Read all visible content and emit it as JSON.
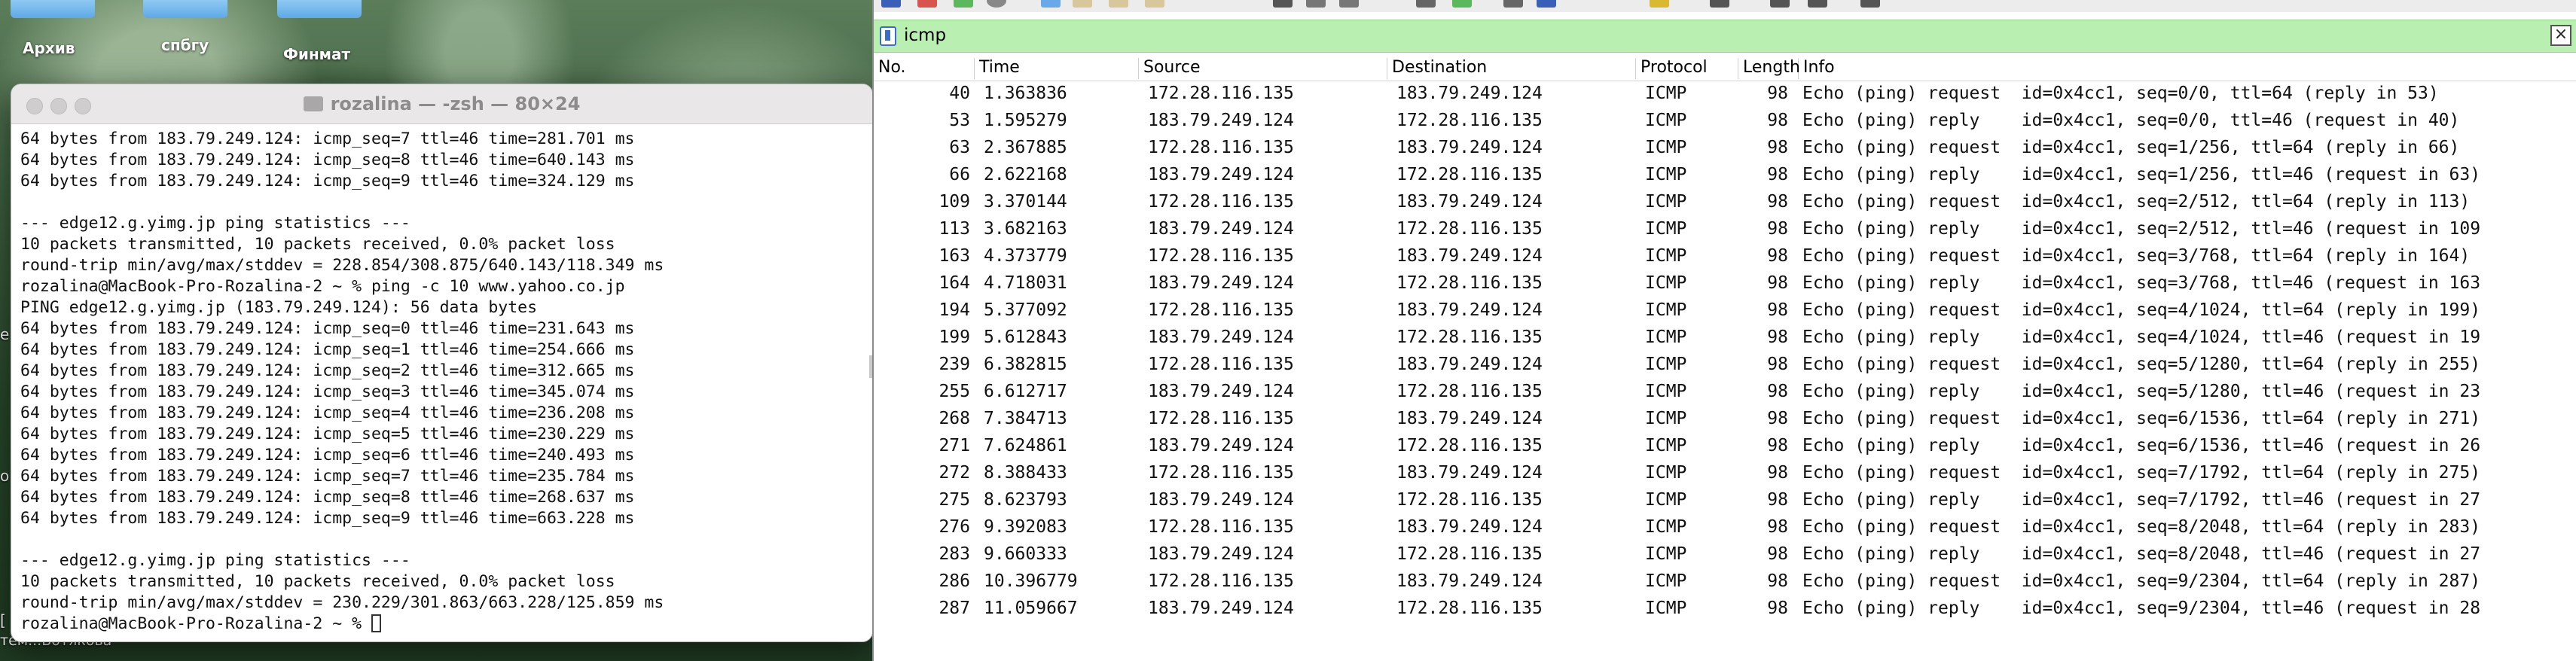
{
  "desktop": {
    "folder_labels": [
      "Архив",
      "спбгу",
      "Финмат"
    ],
    "bottom_label": "тем...Вотякова",
    "edge_glyphs": [
      "е",
      "о",
      "["
    ]
  },
  "terminal": {
    "title": "rozalina — -zsh — 80×24",
    "lines": [
      "64 bytes from 183.79.249.124: icmp_seq=7 ttl=46 time=281.701 ms",
      "64 bytes from 183.79.249.124: icmp_seq=8 ttl=46 time=640.143 ms",
      "64 bytes from 183.79.249.124: icmp_seq=9 ttl=46 time=324.129 ms",
      "",
      "--- edge12.g.yimg.jp ping statistics ---",
      "10 packets transmitted, 10 packets received, 0.0% packet loss",
      "round-trip min/avg/max/stddev = 228.854/308.875/640.143/118.349 ms",
      "rozalina@MacBook-Pro-Rozalina-2 ~ % ping -c 10 www.yahoo.co.jp",
      "PING edge12.g.yimg.jp (183.79.249.124): 56 data bytes",
      "64 bytes from 183.79.249.124: icmp_seq=0 ttl=46 time=231.643 ms",
      "64 bytes from 183.79.249.124: icmp_seq=1 ttl=46 time=254.666 ms",
      "64 bytes from 183.79.249.124: icmp_seq=2 ttl=46 time=312.665 ms",
      "64 bytes from 183.79.249.124: icmp_seq=3 ttl=46 time=345.074 ms",
      "64 bytes from 183.79.249.124: icmp_seq=4 ttl=46 time=236.208 ms",
      "64 bytes from 183.79.249.124: icmp_seq=5 ttl=46 time=230.229 ms",
      "64 bytes from 183.79.249.124: icmp_seq=6 ttl=46 time=240.493 ms",
      "64 bytes from 183.79.249.124: icmp_seq=7 ttl=46 time=235.784 ms",
      "64 bytes from 183.79.249.124: icmp_seq=8 ttl=46 time=268.637 ms",
      "64 bytes from 183.79.249.124: icmp_seq=9 ttl=46 time=663.228 ms",
      "",
      "--- edge12.g.yimg.jp ping statistics ---",
      "10 packets transmitted, 10 packets received, 0.0% packet loss",
      "round-trip min/avg/max/stddev = 230.229/301.863/663.228/125.859 ms"
    ],
    "prompt": "rozalina@MacBook-Pro-Rozalina-2 ~ % "
  },
  "wireshark": {
    "filter": {
      "value": "icmp"
    },
    "columns": [
      "No.",
      "Time",
      "Source",
      "Destination",
      "Protocol",
      "Length",
      "Info"
    ],
    "packets": [
      {
        "no": "40",
        "time": "1.363836",
        "src": "172.28.116.135",
        "dst": "183.79.249.124",
        "proto": "ICMP",
        "len": "98",
        "info": "Echo (ping) request  id=0x4cc1, seq=0/0, ttl=64 (reply in 53)"
      },
      {
        "no": "53",
        "time": "1.595279",
        "src": "183.79.249.124",
        "dst": "172.28.116.135",
        "proto": "ICMP",
        "len": "98",
        "info": "Echo (ping) reply    id=0x4cc1, seq=0/0, ttl=46 (request in 40)"
      },
      {
        "no": "63",
        "time": "2.367885",
        "src": "172.28.116.135",
        "dst": "183.79.249.124",
        "proto": "ICMP",
        "len": "98",
        "info": "Echo (ping) request  id=0x4cc1, seq=1/256, ttl=64 (reply in 66)"
      },
      {
        "no": "66",
        "time": "2.622168",
        "src": "183.79.249.124",
        "dst": "172.28.116.135",
        "proto": "ICMP",
        "len": "98",
        "info": "Echo (ping) reply    id=0x4cc1, seq=1/256, ttl=46 (request in 63)"
      },
      {
        "no": "109",
        "time": "3.370144",
        "src": "172.28.116.135",
        "dst": "183.79.249.124",
        "proto": "ICMP",
        "len": "98",
        "info": "Echo (ping) request  id=0x4cc1, seq=2/512, ttl=64 (reply in 113)"
      },
      {
        "no": "113",
        "time": "3.682163",
        "src": "183.79.249.124",
        "dst": "172.28.116.135",
        "proto": "ICMP",
        "len": "98",
        "info": "Echo (ping) reply    id=0x4cc1, seq=2/512, ttl=46 (request in 109"
      },
      {
        "no": "163",
        "time": "4.373779",
        "src": "172.28.116.135",
        "dst": "183.79.249.124",
        "proto": "ICMP",
        "len": "98",
        "info": "Echo (ping) request  id=0x4cc1, seq=3/768, ttl=64 (reply in 164)"
      },
      {
        "no": "164",
        "time": "4.718031",
        "src": "183.79.249.124",
        "dst": "172.28.116.135",
        "proto": "ICMP",
        "len": "98",
        "info": "Echo (ping) reply    id=0x4cc1, seq=3/768, ttl=46 (request in 163"
      },
      {
        "no": "194",
        "time": "5.377092",
        "src": "172.28.116.135",
        "dst": "183.79.249.124",
        "proto": "ICMP",
        "len": "98",
        "info": "Echo (ping) request  id=0x4cc1, seq=4/1024, ttl=64 (reply in 199)"
      },
      {
        "no": "199",
        "time": "5.612843",
        "src": "183.79.249.124",
        "dst": "172.28.116.135",
        "proto": "ICMP",
        "len": "98",
        "info": "Echo (ping) reply    id=0x4cc1, seq=4/1024, ttl=46 (request in 19"
      },
      {
        "no": "239",
        "time": "6.382815",
        "src": "172.28.116.135",
        "dst": "183.79.249.124",
        "proto": "ICMP",
        "len": "98",
        "info": "Echo (ping) request  id=0x4cc1, seq=5/1280, ttl=64 (reply in 255)"
      },
      {
        "no": "255",
        "time": "6.612717",
        "src": "183.79.249.124",
        "dst": "172.28.116.135",
        "proto": "ICMP",
        "len": "98",
        "info": "Echo (ping) reply    id=0x4cc1, seq=5/1280, ttl=46 (request in 23"
      },
      {
        "no": "268",
        "time": "7.384713",
        "src": "172.28.116.135",
        "dst": "183.79.249.124",
        "proto": "ICMP",
        "len": "98",
        "info": "Echo (ping) request  id=0x4cc1, seq=6/1536, ttl=64 (reply in 271)"
      },
      {
        "no": "271",
        "time": "7.624861",
        "src": "183.79.249.124",
        "dst": "172.28.116.135",
        "proto": "ICMP",
        "len": "98",
        "info": "Echo (ping) reply    id=0x4cc1, seq=6/1536, ttl=46 (request in 26"
      },
      {
        "no": "272",
        "time": "8.388433",
        "src": "172.28.116.135",
        "dst": "183.79.249.124",
        "proto": "ICMP",
        "len": "98",
        "info": "Echo (ping) request  id=0x4cc1, seq=7/1792, ttl=64 (reply in 275)"
      },
      {
        "no": "275",
        "time": "8.623793",
        "src": "183.79.249.124",
        "dst": "172.28.116.135",
        "proto": "ICMP",
        "len": "98",
        "info": "Echo (ping) reply    id=0x4cc1, seq=7/1792, ttl=46 (request in 27"
      },
      {
        "no": "276",
        "time": "9.392083",
        "src": "172.28.116.135",
        "dst": "183.79.249.124",
        "proto": "ICMP",
        "len": "98",
        "info": "Echo (ping) request  id=0x4cc1, seq=8/2048, ttl=64 (reply in 283)"
      },
      {
        "no": "283",
        "time": "9.660333",
        "src": "183.79.249.124",
        "dst": "172.28.116.135",
        "proto": "ICMP",
        "len": "98",
        "info": "Echo (ping) reply    id=0x4cc1, seq=8/2048, ttl=46 (request in 27"
      },
      {
        "no": "286",
        "time": "10.396779",
        "src": "172.28.116.135",
        "dst": "183.79.249.124",
        "proto": "ICMP",
        "len": "98",
        "info": "Echo (ping) request  id=0x4cc1, seq=9/2304, ttl=64 (reply in 287)"
      },
      {
        "no": "287",
        "time": "11.059667",
        "src": "183.79.249.124",
        "dst": "172.28.116.135",
        "proto": "ICMP",
        "len": "98",
        "info": "Echo (ping) reply    id=0x4cc1, seq=9/2304, ttl=46 (request in 28"
      }
    ]
  }
}
